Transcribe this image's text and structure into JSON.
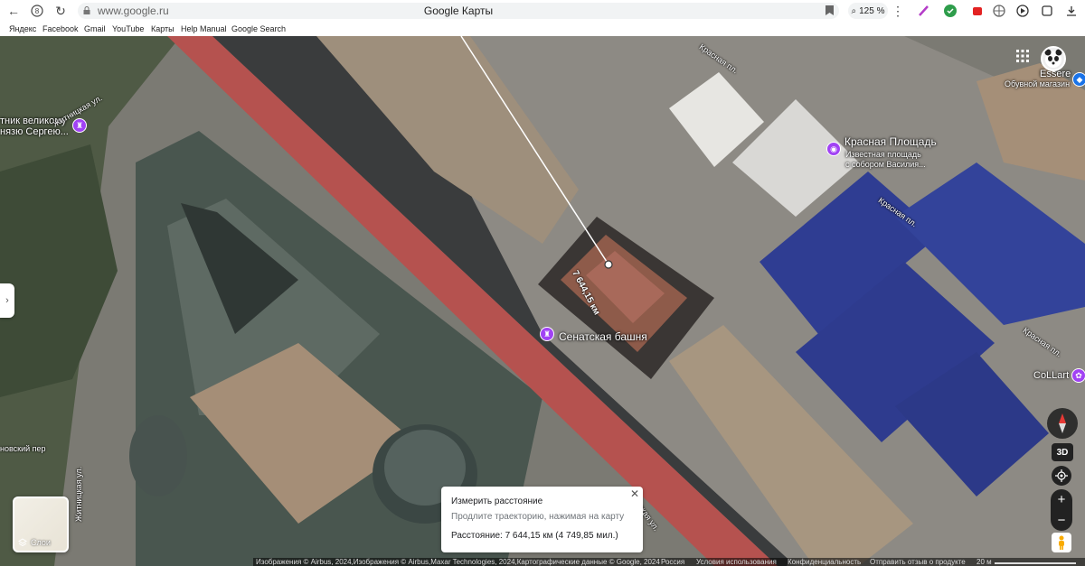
{
  "browser": {
    "url": "www.google.ru",
    "page_title": "Google Карты",
    "zoom": "125 %",
    "bookmarks": [
      "Яндекс",
      "Facebook",
      "Gmail",
      "YouTube",
      "Карты",
      "Help Manual",
      "Google Search"
    ]
  },
  "map": {
    "pois": {
      "senate_tower": "Сенатская башня",
      "red_square_title": "Красная Площадь",
      "red_square_sub1": "Известная площадь",
      "red_square_sub2": "с собором Василия...",
      "monument_line1": "тник великому",
      "monument_line2": "нязю Сергею...",
      "essere_title": "Essere",
      "essere_sub": "Обувной магазин",
      "collart": "CoLLart"
    },
    "streets": {
      "krasnaya_pl_1": "Красная пл.",
      "krasnaya_pl_2": "Красная пл.",
      "krasnaya_pl_3": "Красная пл.",
      "zhitnitsky_1": "Житницкая ул.",
      "zhitnitsky_2": "Житницкая ул.",
      "ovsky_per": "новский пер",
      "spasskaya": "Спасская ул."
    },
    "measure_label": "7 644,15 км"
  },
  "measure_panel": {
    "title": "Измерить расстояние",
    "subtitle": "Продлите траекторию, нажимая на карту",
    "distance": "Расстояние: 7 644,15 км (4 749,85 мил.)"
  },
  "layers_label": "Слои",
  "controls": {
    "three_d": "3D",
    "zoom_in": "+",
    "zoom_out": "−"
  },
  "footer": {
    "attribution": "Изображения © Airbus, 2024,Изображения © Airbus,Maxar Technologies, 2024,Картографические данные © Google, 2024",
    "country": "Россия",
    "terms": "Условия использования",
    "privacy": "Конфиденциальность",
    "feedback": "Отправить отзыв о продукте",
    "scale": "20 м"
  },
  "colors": {
    "pin": "#a142f4",
    "kremlin_wall": "#b5524f",
    "pavement": "#8d8a84"
  }
}
